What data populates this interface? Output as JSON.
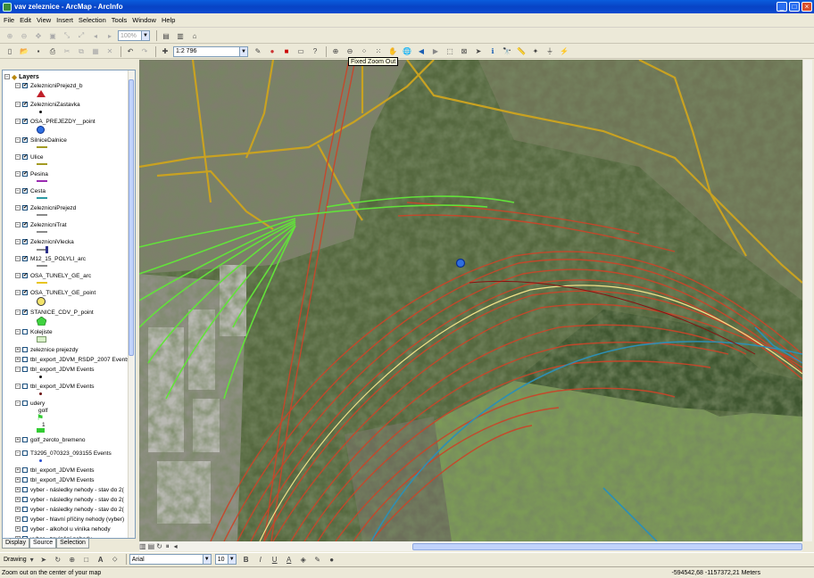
{
  "window": {
    "title": "vav zeleznice - ArcMap - ArcInfo"
  },
  "menu": [
    "File",
    "Edit",
    "View",
    "Insert",
    "Selection",
    "Tools",
    "Window",
    "Help"
  ],
  "standard_toolbar": {
    "scale": "1:2 796",
    "zoom_percent": "100%"
  },
  "tooltip": "Fixed Zoom Out",
  "toc": {
    "root": "Layers",
    "layers": [
      {
        "name": "ZeleznicniPrejezd_b",
        "checked": true,
        "symbol": "triangle-red"
      },
      {
        "name": "ZeleznicniZastavka",
        "checked": true,
        "symbol": "dot-black"
      },
      {
        "name": "OSA_PREJEZDY__point",
        "checked": true,
        "symbol": "circle-blue"
      },
      {
        "name": "SilniceDalnice",
        "checked": true,
        "symbol": "line-olive"
      },
      {
        "name": "Ulice",
        "checked": true,
        "symbol": "line-olive"
      },
      {
        "name": "Pesina",
        "checked": true,
        "symbol": "line-purple"
      },
      {
        "name": "Cesta",
        "checked": true,
        "symbol": "line-teal"
      },
      {
        "name": "ZeleznicniPrejezd",
        "checked": true,
        "symbol": "line-grey"
      },
      {
        "name": "ZeleznicniTrat",
        "checked": true,
        "symbol": "line-grey"
      },
      {
        "name": "ZeleznicniVlecka",
        "checked": true,
        "symbol": "line-darkblue"
      },
      {
        "name": "M12_15_POLYLI_arc",
        "checked": true,
        "symbol": "line-grey"
      },
      {
        "name": "OSA_TUNELY_GE_arc",
        "checked": true,
        "symbol": "line-yellow"
      },
      {
        "name": "OSA_TUNELY_GE_point",
        "checked": true,
        "symbol": "circle-yellow"
      },
      {
        "name": "STANICE_CDV_P_point",
        "checked": true,
        "symbol": "pentagon-green"
      },
      {
        "name": "Kolejiste",
        "checked": false,
        "symbol": "rect-lightgreen"
      },
      {
        "name": "zeleznice prejezdy",
        "checked": false,
        "symbol": ""
      },
      {
        "name": "tbl_export_JDVM_RSDP_2007 Events",
        "checked": false,
        "symbol": ""
      },
      {
        "name": "tbl_export_JDVM Events",
        "checked": false,
        "symbol": "dot-black"
      },
      {
        "name": "tbl_export_JDVM Events",
        "checked": false,
        "symbol": "dot-darkred"
      },
      {
        "name": "udery",
        "checked": false,
        "symbol": "flag"
      },
      {
        "name": "golf_zeroto_bremeno",
        "checked": false,
        "symbol": ""
      },
      {
        "name": "T3295_070323_093155 Events",
        "checked": false,
        "symbol": "dot-blue"
      },
      {
        "name": "tbl_export_JDVM Events",
        "checked": false,
        "symbol": ""
      },
      {
        "name": "tbl_export_JDVM Events",
        "checked": false,
        "symbol": ""
      },
      {
        "name": "vyber - následky nehody - stav do 2(",
        "checked": false,
        "symbol": ""
      },
      {
        "name": "vyber - následky nehody - stav do 2(",
        "checked": false,
        "symbol": ""
      },
      {
        "name": "vyber - následky nehody - stav do 2(",
        "checked": false,
        "symbol": ""
      },
      {
        "name": "vyber - hlavní příčiny nehody (vyber)",
        "checked": false,
        "symbol": ""
      },
      {
        "name": "vyber - alkohol u viníka nehody",
        "checked": false,
        "symbol": ""
      },
      {
        "name": "vyber - zavinění nehody",
        "checked": false,
        "symbol": ""
      }
    ],
    "udery_sub": {
      "golf": "golf",
      "one": "1"
    },
    "tabs": [
      "Display",
      "Source",
      "Selection"
    ]
  },
  "drawing_toolbar": {
    "drawing_label": "Drawing",
    "font": "Arial",
    "size": "10"
  },
  "status": {
    "message": "Zoom out on the center of your map",
    "coords": "-594542,68  -1157372,21 Meters"
  }
}
